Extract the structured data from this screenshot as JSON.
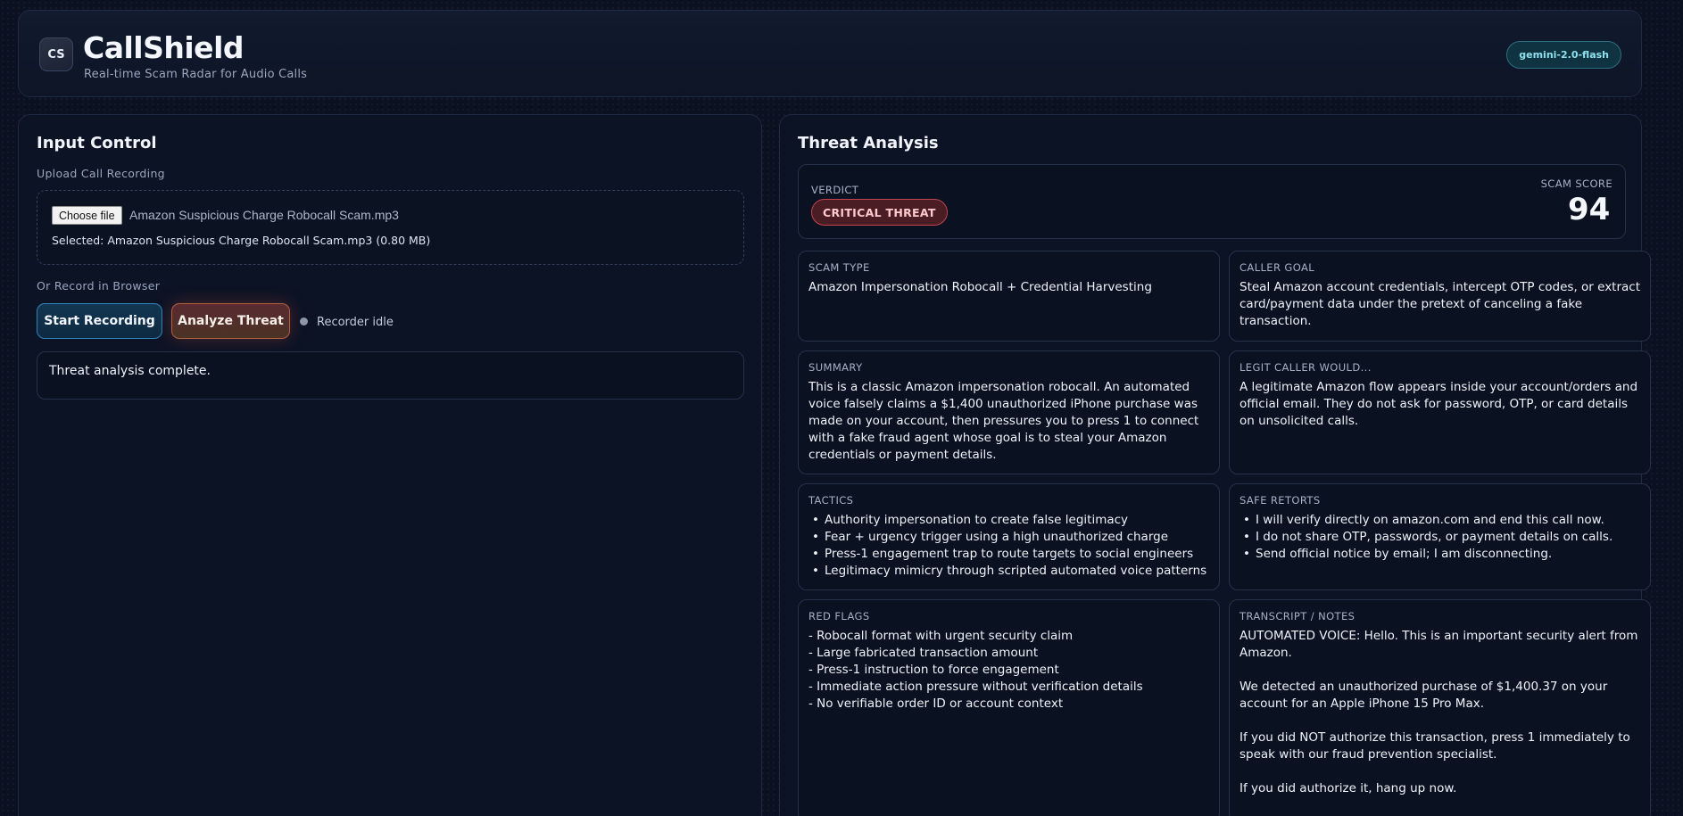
{
  "header": {
    "logo": "CS",
    "title": "CallShield",
    "subtitle": "Real-time Scam Radar for Audio Calls",
    "model": "gemini-2.0-flash"
  },
  "input_control": {
    "title": "Input Control",
    "upload_label": "Upload Call Recording",
    "choose_file": "Choose file",
    "file_name": "Amazon Suspicious Charge Robocall Scam.mp3",
    "selected": "Selected: Amazon Suspicious Charge Robocall Scam.mp3 (0.80 MB)",
    "record_label": "Or Record in Browser",
    "start_recording": "Start Recording",
    "analyze_threat": "Analyze Threat",
    "recorder_status": "Recorder idle",
    "status_message": "Threat analysis complete."
  },
  "threat_analysis": {
    "title": "Threat Analysis",
    "verdict_label": "VERDICT",
    "verdict": "CRITICAL THREAT",
    "score_label": "SCAM SCORE",
    "score": "94",
    "scam_type": {
      "label": "SCAM TYPE",
      "text": "Amazon Impersonation Robocall + Credential Harvesting"
    },
    "caller_goal": {
      "label": "CALLER GOAL",
      "text": "Steal Amazon account credentials, intercept OTP codes, or extract card/payment data under the pretext of canceling a fake transaction."
    },
    "summary": {
      "label": "SUMMARY",
      "text": "This is a classic Amazon impersonation robocall. An automated voice falsely claims a $1,400 unauthorized iPhone purchase was made on your account, then pressures you to press 1 to connect with a fake fraud agent whose goal is to steal your Amazon credentials or payment details."
    },
    "legit_caller": {
      "label": "LEGIT CALLER WOULD...",
      "text": "A legitimate Amazon flow appears inside your account/orders and official email. They do not ask for password, OTP, or card details on unsolicited calls."
    },
    "tactics": {
      "label": "TACTICS",
      "items": [
        "Authority impersonation to create false legitimacy",
        "Fear + urgency trigger using a high unauthorized charge",
        "Press-1 engagement trap to route targets to social engineers",
        "Legitimacy mimicry through scripted automated voice patterns"
      ]
    },
    "safe_retorts": {
      "label": "SAFE RETORTS",
      "items": [
        "I will verify directly on amazon.com and end this call now.",
        "I do not share OTP, passwords, or payment details on calls.",
        "Send official notice by email; I am disconnecting."
      ]
    },
    "red_flags": {
      "label": "RED FLAGS",
      "items": [
        "- Robocall format with urgent security claim",
        "- Large fabricated transaction amount",
        "- Press-1 instruction to force engagement",
        "- Immediate action pressure without verification details",
        "- No verifiable order ID or account context"
      ]
    },
    "transcript": {
      "label": "TRANSCRIPT / NOTES",
      "paragraphs": [
        "AUTOMATED VOICE: Hello. This is an important security alert from Amazon.",
        "We detected an unauthorized purchase of $1,400.37 on your account for an Apple iPhone 15 Pro Max.",
        "If you did NOT authorize this transaction, press 1 immediately to speak with our fraud prevention specialist.",
        "If you did authorize it, hang up now."
      ]
    }
  }
}
